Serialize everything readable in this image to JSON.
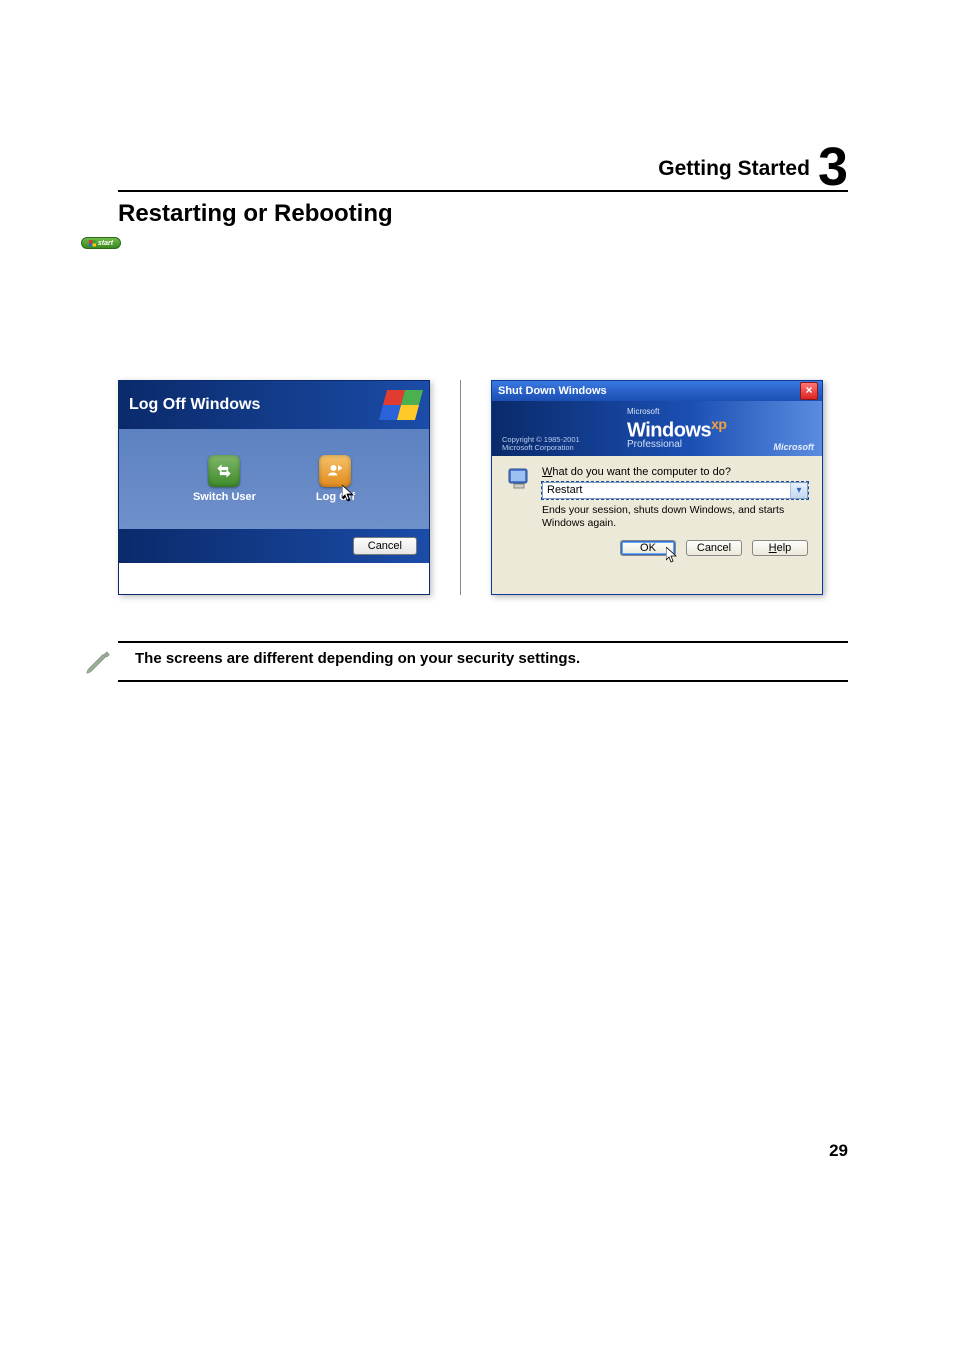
{
  "header": {
    "title": "Getting Started",
    "chapter": "3"
  },
  "section": {
    "title": "Restarting or Rebooting"
  },
  "start_button": {
    "label": "start"
  },
  "logoff_dialog": {
    "title": "Log Off Windows",
    "switch_user_label": "Switch User",
    "log_off_label": "Log Off",
    "cancel_label": "Cancel"
  },
  "shutdown_dialog": {
    "title": "Shut Down Windows",
    "banner_ms": "Microsoft",
    "banner_windows": "Windows",
    "banner_xp": "xp",
    "banner_pro": "Professional",
    "copyright_line1": "Copyright © 1985-2001",
    "copyright_line2": "Microsoft Corporation",
    "brand": "Microsoft",
    "question_prefix": "W",
    "question_rest": "hat do you want the computer to do?",
    "select_value": "Restart",
    "description": "Ends your session, shuts down Windows, and starts Windows again.",
    "ok_label": "OK",
    "cancel_label": "Cancel",
    "help_prefix": "H",
    "help_rest": "elp"
  },
  "note": {
    "text": "The screens are different depending on your security settings."
  },
  "page_number": "29"
}
